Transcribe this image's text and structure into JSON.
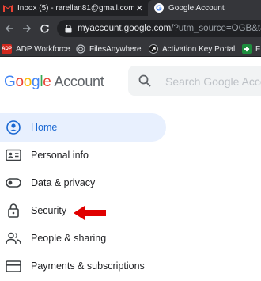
{
  "browser": {
    "tabs": [
      {
        "label": "Inbox (5) - rarellan81@gmail.com",
        "icon": "gmail-icon",
        "active": false,
        "close": "✕"
      },
      {
        "label": "Google Account",
        "icon": "google-icon",
        "active": true,
        "close": "✕"
      }
    ],
    "url_domain": "myaccount.google.com",
    "url_path": "/?utm_source=OGB&ta",
    "bookmarks": [
      {
        "label": "ADP Workforce",
        "icon": "adp-icon"
      },
      {
        "label": "FilesAnywhere",
        "icon": "filesanywhere-icon"
      },
      {
        "label": "Activation Key Portal",
        "icon": "activation-key-icon"
      },
      {
        "label": "F",
        "icon": "green-bookmark-icon"
      }
    ]
  },
  "header": {
    "logo_google": "Google",
    "logo_account": "Account",
    "search_placeholder": "Search Google Acco"
  },
  "nav": {
    "items": [
      {
        "label": "Home",
        "icon": "home-person-icon",
        "active": true
      },
      {
        "label": "Personal info",
        "icon": "id-card-icon",
        "active": false
      },
      {
        "label": "Data & privacy",
        "icon": "toggle-icon",
        "active": false
      },
      {
        "label": "Security",
        "icon": "lock-icon",
        "active": false
      },
      {
        "label": "People & sharing",
        "icon": "people-icon",
        "active": false
      },
      {
        "label": "Payments & subscriptions",
        "icon": "credit-card-icon",
        "active": false
      }
    ]
  },
  "annotation": {
    "arrow_color": "#e00000",
    "points_to": "Security"
  },
  "colors": {
    "active_bg": "#e8f0fe",
    "active_text": "#1967d2",
    "chrome_dark": "#202124"
  }
}
